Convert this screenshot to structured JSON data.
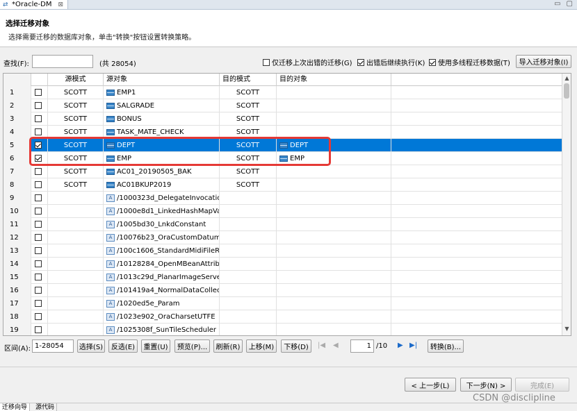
{
  "tab": {
    "title": "*Oracle-DM",
    "close": "⊠"
  },
  "window_controls": [
    "▭",
    "▢"
  ],
  "header": {
    "title": "选择迁移对象",
    "description": "选择需要迁移的数据库对象，单击\"转换\"按钮设置转换策略。"
  },
  "find": {
    "label": "查找(F):",
    "value": "",
    "count": "(共 28054)"
  },
  "options": {
    "only_failed": {
      "label": "仅迁移上次出错的迁移(G)",
      "checked": false
    },
    "continue_on_error": {
      "label": "出错后继续执行(K)",
      "checked": true
    },
    "multithread": {
      "label": "使用多线程迁移数据(T)",
      "checked": true
    }
  },
  "import_button": "导入迁移对象(I)",
  "columns": {
    "source_schema": "源模式",
    "source_object": "源对象",
    "target_schema": "目的模式",
    "target_object": "目的对象"
  },
  "rows": [
    {
      "idx": "1",
      "checked": false,
      "ss": "SCOTT",
      "so": "EMP1",
      "so_icon": "table",
      "ts": "SCOTT",
      "to": "",
      "selected": false
    },
    {
      "idx": "2",
      "checked": false,
      "ss": "SCOTT",
      "so": "SALGRADE",
      "so_icon": "table",
      "ts": "SCOTT",
      "to": "",
      "selected": false
    },
    {
      "idx": "3",
      "checked": false,
      "ss": "SCOTT",
      "so": "BONUS",
      "so_icon": "table",
      "ts": "SCOTT",
      "to": "",
      "selected": false
    },
    {
      "idx": "4",
      "checked": false,
      "ss": "SCOTT",
      "so": "TASK_MATE_CHECK",
      "so_icon": "table",
      "ts": "SCOTT",
      "to": "",
      "selected": false
    },
    {
      "idx": "5",
      "checked": true,
      "ss": "SCOTT",
      "so": "DEPT",
      "so_icon": "table",
      "ts": "SCOTT",
      "to": "DEPT",
      "selected": true
    },
    {
      "idx": "6",
      "checked": true,
      "ss": "SCOTT",
      "so": "EMP",
      "so_icon": "table",
      "ts": "SCOTT",
      "to": "EMP",
      "selected": false
    },
    {
      "idx": "7",
      "checked": false,
      "ss": "SCOTT",
      "so": "AC01_20190505_BAK",
      "so_icon": "table",
      "ts": "SCOTT",
      "to": "",
      "selected": false
    },
    {
      "idx": "8",
      "checked": false,
      "ss": "SCOTT",
      "so": "AC01BKUP2019",
      "so_icon": "table",
      "ts": "SCOTT",
      "to": "",
      "selected": false
    },
    {
      "idx": "9",
      "checked": false,
      "ss": "",
      "so": "/1000323d_DelegateInvocatio.",
      "so_icon": "object",
      "ts": "",
      "to": "",
      "selected": false
    },
    {
      "idx": "10",
      "checked": false,
      "ss": "",
      "so": "/1000e8d1_LinkedHashMapVa",
      "so_icon": "object",
      "ts": "",
      "to": "",
      "selected": false
    },
    {
      "idx": "11",
      "checked": false,
      "ss": "",
      "so": "/1005bd30_LnkdConstant",
      "so_icon": "object",
      "ts": "",
      "to": "",
      "selected": false
    },
    {
      "idx": "12",
      "checked": false,
      "ss": "",
      "so": "/10076b23_OraCustomDatumC",
      "so_icon": "object",
      "ts": "",
      "to": "",
      "selected": false
    },
    {
      "idx": "13",
      "checked": false,
      "ss": "",
      "so": "/100c1606_StandardMidiFileR..",
      "so_icon": "object",
      "ts": "",
      "to": "",
      "selected": false
    },
    {
      "idx": "14",
      "checked": false,
      "ss": "",
      "so": "/10128284_OpenMBeanAttribu",
      "so_icon": "object",
      "ts": "",
      "to": "",
      "selected": false
    },
    {
      "idx": "15",
      "checked": false,
      "ss": "",
      "so": "/1013c29d_PlanarImageServer",
      "so_icon": "object",
      "ts": "",
      "to": "",
      "selected": false
    },
    {
      "idx": "16",
      "checked": false,
      "ss": "",
      "so": "/101419a4_NormalDataCollect",
      "so_icon": "object",
      "ts": "",
      "to": "",
      "selected": false
    },
    {
      "idx": "17",
      "checked": false,
      "ss": "",
      "so": "/1020ed5e_Param",
      "so_icon": "object",
      "ts": "",
      "to": "",
      "selected": false
    },
    {
      "idx": "18",
      "checked": false,
      "ss": "",
      "so": "/1023e902_OraCharsetUTFE",
      "so_icon": "object",
      "ts": "",
      "to": "",
      "selected": false
    },
    {
      "idx": "19",
      "checked": false,
      "ss": "",
      "so": "/1025308f_SunTileScheduler",
      "so_icon": "object",
      "ts": "",
      "to": "",
      "selected": false
    }
  ],
  "range": {
    "label": "区间(A):",
    "value": "1-28054"
  },
  "toolbar": {
    "select": "选择(S)",
    "invert": "反选(E)",
    "reset": "重置(U)",
    "preview": "预览(P)...",
    "refresh": "刷新(R)",
    "move_up": "上移(M)",
    "move_down": "下移(D)",
    "first": "|◀",
    "prev": "◀",
    "next": "▶",
    "last": "▶|",
    "convert": "转换(B)..."
  },
  "pager": {
    "page": "1",
    "total": "/10"
  },
  "wizard": {
    "back": "< 上一步(L)",
    "next": "下一步(N) >",
    "finish": "完成(E)"
  },
  "bottom_tabs": [
    "迁移向导",
    "源代码"
  ],
  "watermark": "CSDN @disclipline",
  "colors": {
    "selection": "#0078d7",
    "highlight_box": "#e53935",
    "table_icon": "#3a86c8"
  }
}
